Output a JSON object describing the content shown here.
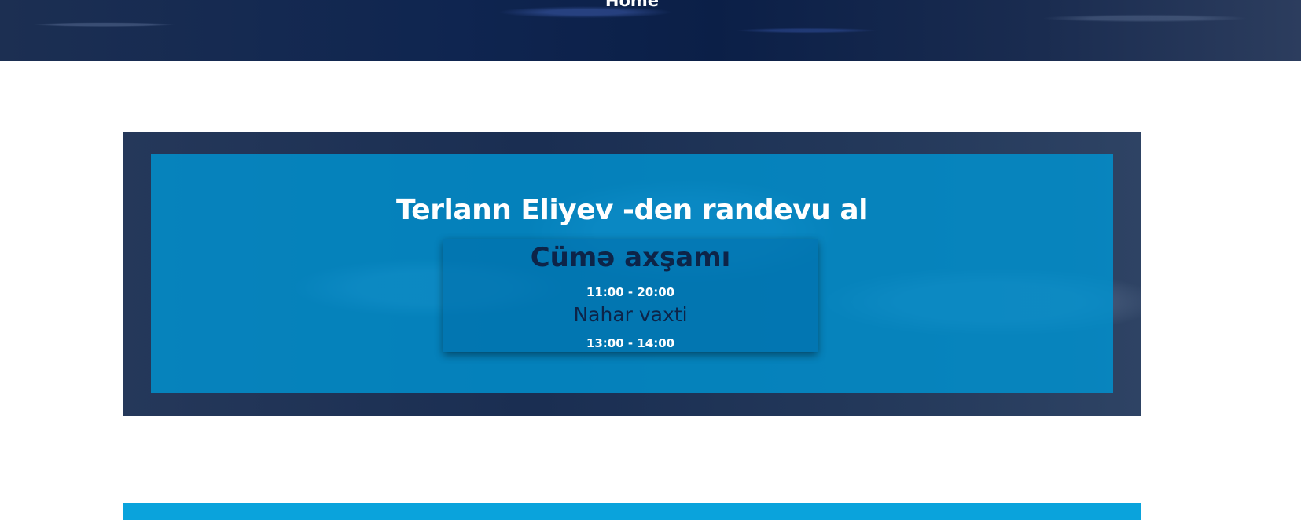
{
  "hero": {
    "title": "Home"
  },
  "appointment": {
    "headline": "Terlann Eliyev -den randevu al",
    "day": "Cümə axşamı",
    "working_hours": "11:00 - 20:00",
    "lunch_label": "Nahar vaxti",
    "lunch_hours": "13:00 - 14:00"
  },
  "colors": {
    "overlay_blue": "#0094d2",
    "dark_navy": "#0d2448",
    "strip_blue": "#0aa3dc"
  }
}
